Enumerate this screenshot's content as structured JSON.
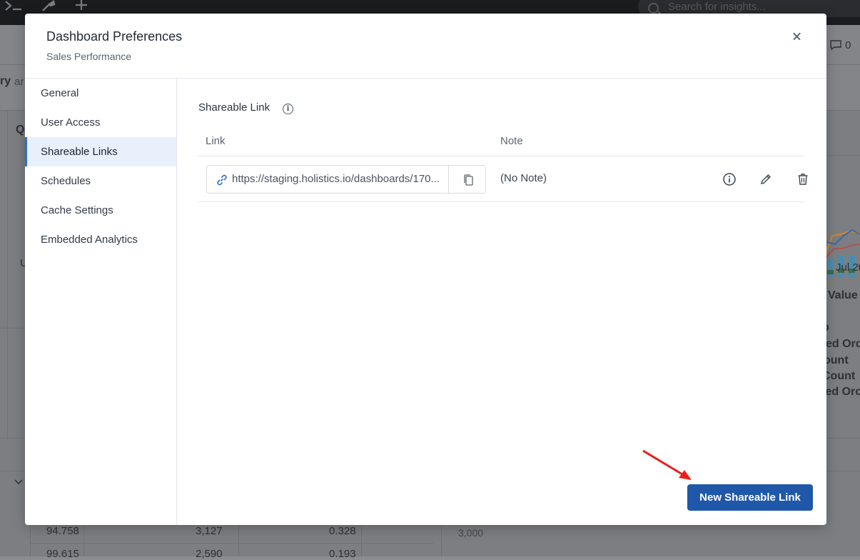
{
  "background": {
    "search_placeholder": "Search for insights...",
    "comment_count": "0",
    "texts": {
      "ry": "ry",
      "ar": "ar",
      "q": "Q",
      "u": "U",
      "jul": "Jul 20",
      "value": "Value",
      "p": "p",
      "ed_orc": "ed Orc",
      "ount": "ount",
      "count": "Count",
      "ed_orc2": "led Orc",
      "row1_a": "94.758",
      "row1_b": "3,127",
      "row1_c": "0.328",
      "row2_a": "99.615",
      "row2_b": "2,590",
      "row2_c": "0.193",
      "axis_3000": "3,000"
    }
  },
  "modal": {
    "title": "Dashboard Preferences",
    "subtitle": "Sales Performance",
    "sidebar": {
      "items": [
        {
          "label": "General"
        },
        {
          "label": "User Access"
        },
        {
          "label": "Shareable Links"
        },
        {
          "label": "Schedules"
        },
        {
          "label": "Cache Settings"
        },
        {
          "label": "Embedded Analytics"
        }
      ],
      "active_index": 2
    },
    "section_title": "Shareable Link",
    "table": {
      "headers": {
        "link": "Link",
        "note": "Note"
      },
      "rows": [
        {
          "link": "https://staging.holistics.io/dashboards/170...",
          "note": "(No Note)"
        }
      ]
    },
    "new_link_button": "New Shareable Link"
  },
  "colors": {
    "primary": "#1f58a8",
    "active_nav_bg": "#e8f0fc",
    "active_nav_border": "#2f6fd0",
    "annotation": "#e8201a"
  }
}
